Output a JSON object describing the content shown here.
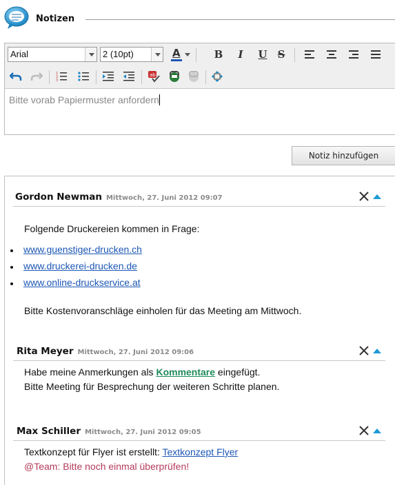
{
  "section": {
    "title": "Notizen"
  },
  "toolbar": {
    "font_family": "Arial",
    "font_size": "2 (10pt)",
    "font_color_label": "A",
    "bold_label": "B",
    "italic_label": "I",
    "underline_label": "U",
    "strike_label": "S"
  },
  "editor": {
    "content": "Bitte vorab Papiermuster anfordern"
  },
  "add_button": {
    "label": "Notiz hinzufügen"
  },
  "colors": {
    "accent": "#1e9ad6",
    "link": "#1c57b5",
    "green_link": "#1e8a5a",
    "mention": "#b53a5a"
  },
  "notes": [
    {
      "author": "Gordon Newman",
      "date": "Mittwoch, 27. Juni 2012 09:07",
      "intro": "Folgende Druckereien kommen in Frage:",
      "links": [
        "www.guenstiger-drucken.ch",
        "www.druckerei-drucken.de",
        "www.online-druckservice.at"
      ],
      "outro": "Bitte Kostenvoranschläge einholen für das Meeting am Mittwoch."
    },
    {
      "author": "Rita Meyer",
      "date": "Mittwoch, 27. Juni 2012 09:06",
      "line1_before": "Habe meine Anmerkungen als ",
      "line1_link": "Kommentare",
      "line1_after": " eingefügt.",
      "line2": "Bitte Meeting für Besprechung der weiteren Schritte planen."
    },
    {
      "author": "Max Schiller",
      "date": "Mittwoch, 27. Juni 2012 09:05",
      "line1_before": "Textkonzept für Flyer ist erstellt: ",
      "line1_link": "Textkonzept Flyer",
      "line2": "@Team: Bitte noch einmal überprüfen!"
    }
  ]
}
